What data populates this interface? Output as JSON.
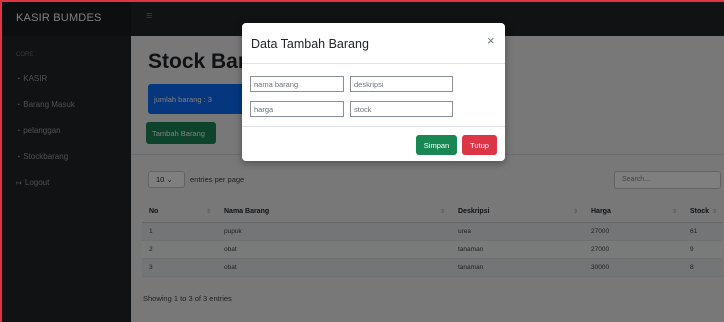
{
  "topbar": {
    "brand": "KASIR BUMDES",
    "toggle_icon": "≡"
  },
  "sidebar": {
    "heading": "CORE",
    "items": [
      {
        "label": "KASIR",
        "icon": "◔"
      },
      {
        "label": "Barang Masuk",
        "icon": "◔"
      },
      {
        "label": "pelanggan",
        "icon": "◔"
      },
      {
        "label": "Stockbarang",
        "icon": "◔"
      },
      {
        "label": "Logout",
        "icon": "↦"
      }
    ]
  },
  "main": {
    "title": "Stock Bara",
    "count_label": "jumlah barang : 3",
    "add_button": "Tambah Barang",
    "per_page_value": "10",
    "per_page_caret": "⌄",
    "per_page_label": "entries per page",
    "search_placeholder": "Search...",
    "table": {
      "sort_icon": "⇕",
      "columns": [
        "No",
        "Nama Barang",
        "Deskripsi",
        "Harga",
        "Stock"
      ],
      "rows": [
        [
          "1",
          "pupuk",
          "urea",
          "27000",
          "61"
        ],
        [
          "2",
          "obat",
          "tanaman",
          "27000",
          "9"
        ],
        [
          "3",
          "obat",
          "tanaman",
          "30000",
          "8"
        ]
      ]
    },
    "showing": "Showing 1 to 3 of 3 entries"
  },
  "modal": {
    "title": "Data Tambah Barang",
    "close_icon": "×",
    "fields": {
      "nama_placeholder": "nama barang",
      "deskripsi_placeholder": "deskripsi",
      "harga_placeholder": "harga",
      "stock_placeholder": "stock"
    },
    "save_label": "Simpan",
    "close_label": "Tutup"
  },
  "colors": {
    "primary": "#0d6efd",
    "success": "#198754",
    "danger": "#dc3545",
    "sidebar": "#212529"
  }
}
